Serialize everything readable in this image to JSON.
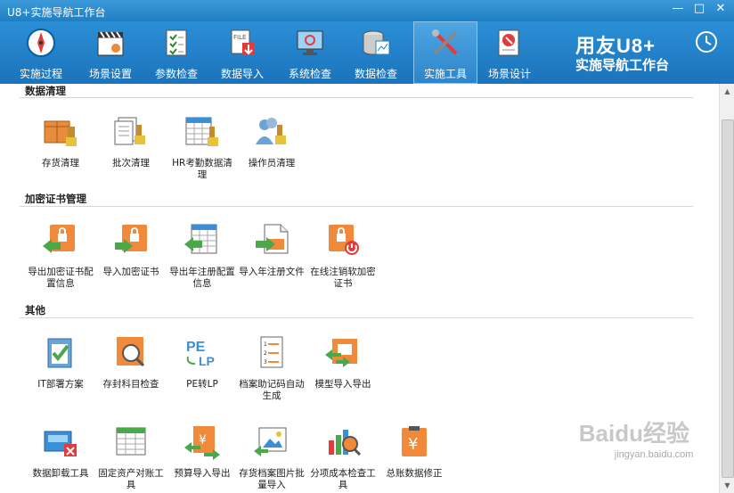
{
  "window": {
    "title": "U8+实施导航工作台"
  },
  "toolbar": {
    "items": [
      {
        "label": "实施过程",
        "icon": "compass-icon"
      },
      {
        "label": "场景设置",
        "icon": "clapperboard-icon"
      },
      {
        "label": "参数检查",
        "icon": "checklist-icon"
      },
      {
        "label": "数据导入",
        "icon": "file-import-icon"
      },
      {
        "label": "系统检查",
        "icon": "monitor-icon"
      },
      {
        "label": "数据检查",
        "icon": "database-icon"
      },
      {
        "label": "实施工具",
        "icon": "tools-icon"
      },
      {
        "label": "场景设计",
        "icon": "design-icon"
      }
    ],
    "active": "实施工具"
  },
  "brand": {
    "line1": "用友U8+",
    "line2": "实施导航工作台"
  },
  "sections": [
    {
      "title": "数据清理",
      "tools": [
        {
          "label": "存货清理",
          "icon": "inventory-clean-icon"
        },
        {
          "label": "批次清理",
          "icon": "batch-clean-icon"
        },
        {
          "label": "HR考勤数据清理",
          "icon": "hr-clean-icon"
        },
        {
          "label": "操作员清理",
          "icon": "operator-clean-icon"
        }
      ]
    },
    {
      "title": "加密证书管理",
      "tools": [
        {
          "label": "导出加密证书配置信息",
          "icon": "export-cert-icon"
        },
        {
          "label": "导入加密证书",
          "icon": "import-cert-icon"
        },
        {
          "label": "导出年注册配置信息",
          "icon": "export-reg-icon"
        },
        {
          "label": "导入年注册文件",
          "icon": "import-reg-icon"
        },
        {
          "label": "在线注销软加密证书",
          "icon": "cancel-cert-icon"
        }
      ]
    },
    {
      "title": "其他",
      "tools": [
        {
          "label": "IT部署方案",
          "icon": "it-deploy-icon"
        },
        {
          "label": "存封科目检查",
          "icon": "account-check-icon"
        },
        {
          "label": "PE转LP",
          "icon": "pe-lp-icon"
        },
        {
          "label": "档案助记码自动生成",
          "icon": "mnemonic-icon"
        },
        {
          "label": "模型导入导出",
          "icon": "model-io-icon"
        },
        {
          "label": "数据卸载工具",
          "icon": "data-unload-icon"
        },
        {
          "label": "固定资产对账工具",
          "icon": "asset-recon-icon"
        },
        {
          "label": "预算导入导出",
          "icon": "budget-io-icon"
        },
        {
          "label": "存货档案图片批量导入",
          "icon": "image-import-icon"
        },
        {
          "label": "分项成本检查工具",
          "icon": "cost-check-icon"
        },
        {
          "label": "总账数据修正",
          "icon": "ledger-fix-icon"
        }
      ]
    }
  ],
  "watermark": {
    "text": "Baidu经验",
    "url": "jingyan.baidu.com"
  },
  "colors": {
    "titlebar": "#1f7fc4",
    "toolbar": "#1b73bb",
    "accent_orange": "#f0893a",
    "accent_green": "#4aa84a"
  }
}
